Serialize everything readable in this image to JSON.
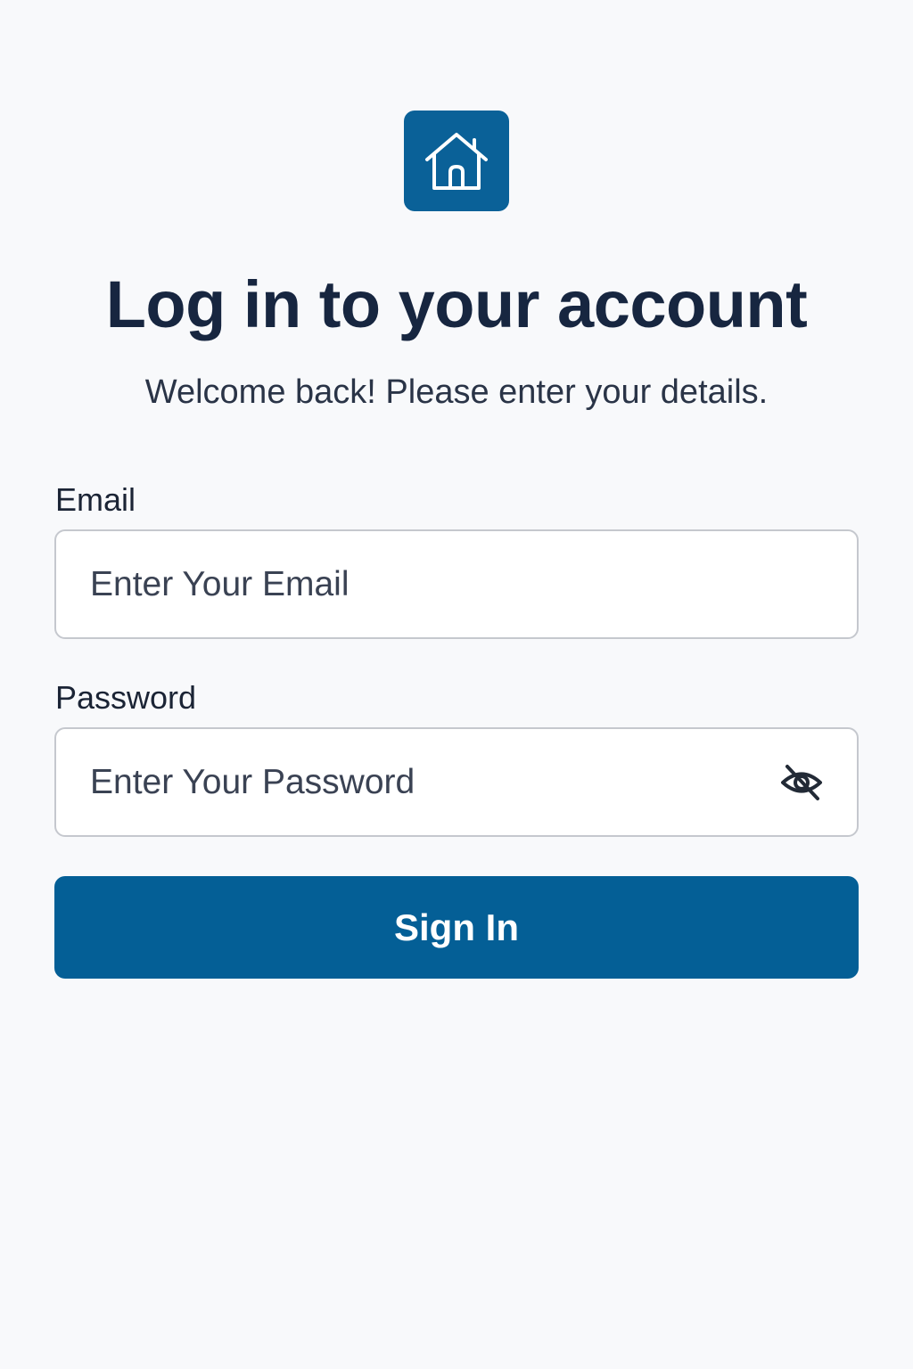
{
  "brand": {
    "logo_icon": "home-icon",
    "accent_color": "#0a6198"
  },
  "header": {
    "title": "Log in to your account",
    "subtitle": "Welcome back! Please enter your details."
  },
  "form": {
    "email": {
      "label": "Email",
      "value": "",
      "placeholder": "Enter Your Email"
    },
    "password": {
      "label": "Password",
      "value": "",
      "placeholder": "Enter Your Password",
      "toggle_icon": "eye-off-icon"
    },
    "submit_label": "Sign In"
  }
}
